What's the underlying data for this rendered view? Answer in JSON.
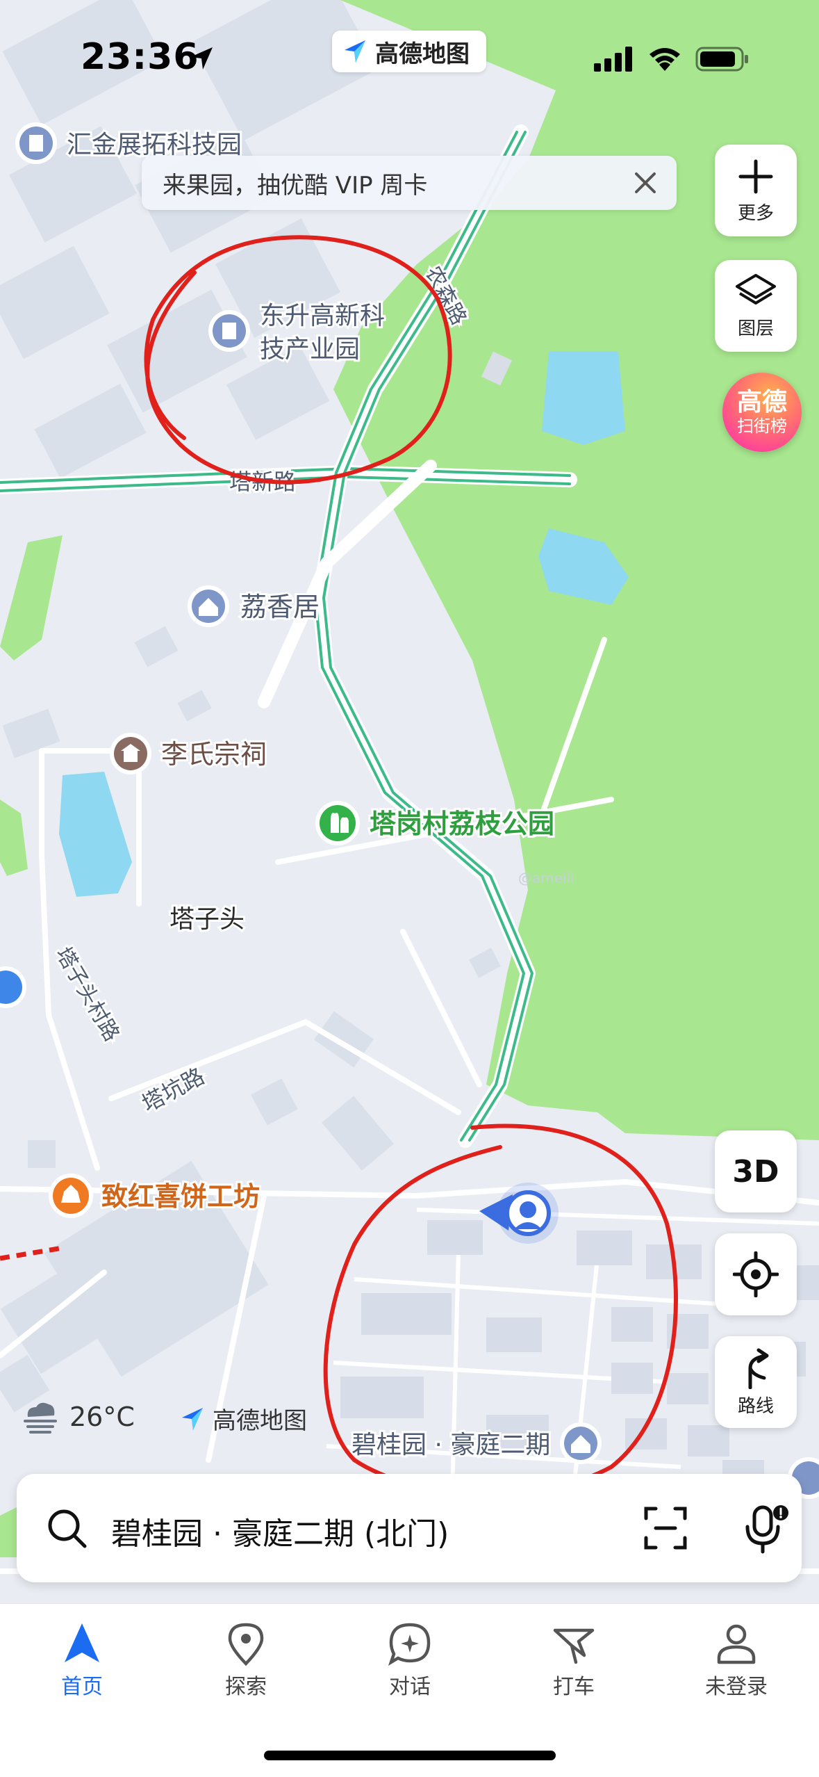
{
  "status_bar": {
    "time": "23:36"
  },
  "app_pill": {
    "name": "高德地图"
  },
  "banner": {
    "text": "来果园，抽优酷 VIP 周卡"
  },
  "controls": {
    "more_label": "更多",
    "layers_label": "图层",
    "rank_line1": "高德",
    "rank_line2": "扫街榜",
    "view_3d": "3D",
    "route_label": "路线"
  },
  "map": {
    "pois": {
      "huijin": "汇金展拓科技园",
      "dongsheng_1": "东升高新科",
      "dongsheng_2": "技产业园",
      "lixiangju": "荔香居",
      "li_ancestral": "李氏宗祠",
      "tagang_park": "塔岗村荔枝公园",
      "tazitou": "塔子头",
      "zhihong": "致红喜饼工坊",
      "biguiyuan": "碧桂园 · 豪庭二期"
    },
    "roads": {
      "nongsen": "农森路",
      "taxin": "塔新路",
      "tazitou_village": "塔子头村路",
      "takeng": "塔坑路"
    },
    "credit": "@ameili"
  },
  "weather": {
    "temp": "26°C"
  },
  "watermark": {
    "name": "高德地图"
  },
  "search": {
    "value": "碧桂园 · 豪庭二期 (北门)"
  },
  "tabs": [
    {
      "label": "首页",
      "icon": "navigate-arrow-icon",
      "active": true
    },
    {
      "label": "探索",
      "icon": "location-pin-icon",
      "active": false
    },
    {
      "label": "对话",
      "icon": "chat-sparkle-icon",
      "active": false
    },
    {
      "label": "打车",
      "icon": "taxi-flag-icon",
      "active": false
    },
    {
      "label": "未登录",
      "icon": "user-icon",
      "active": false
    }
  ],
  "colors": {
    "park_green": "#a8e68f",
    "road_green": "#3cba8a",
    "annotation_red": "#e0211b",
    "brand_blue": "#1c6cf2"
  }
}
